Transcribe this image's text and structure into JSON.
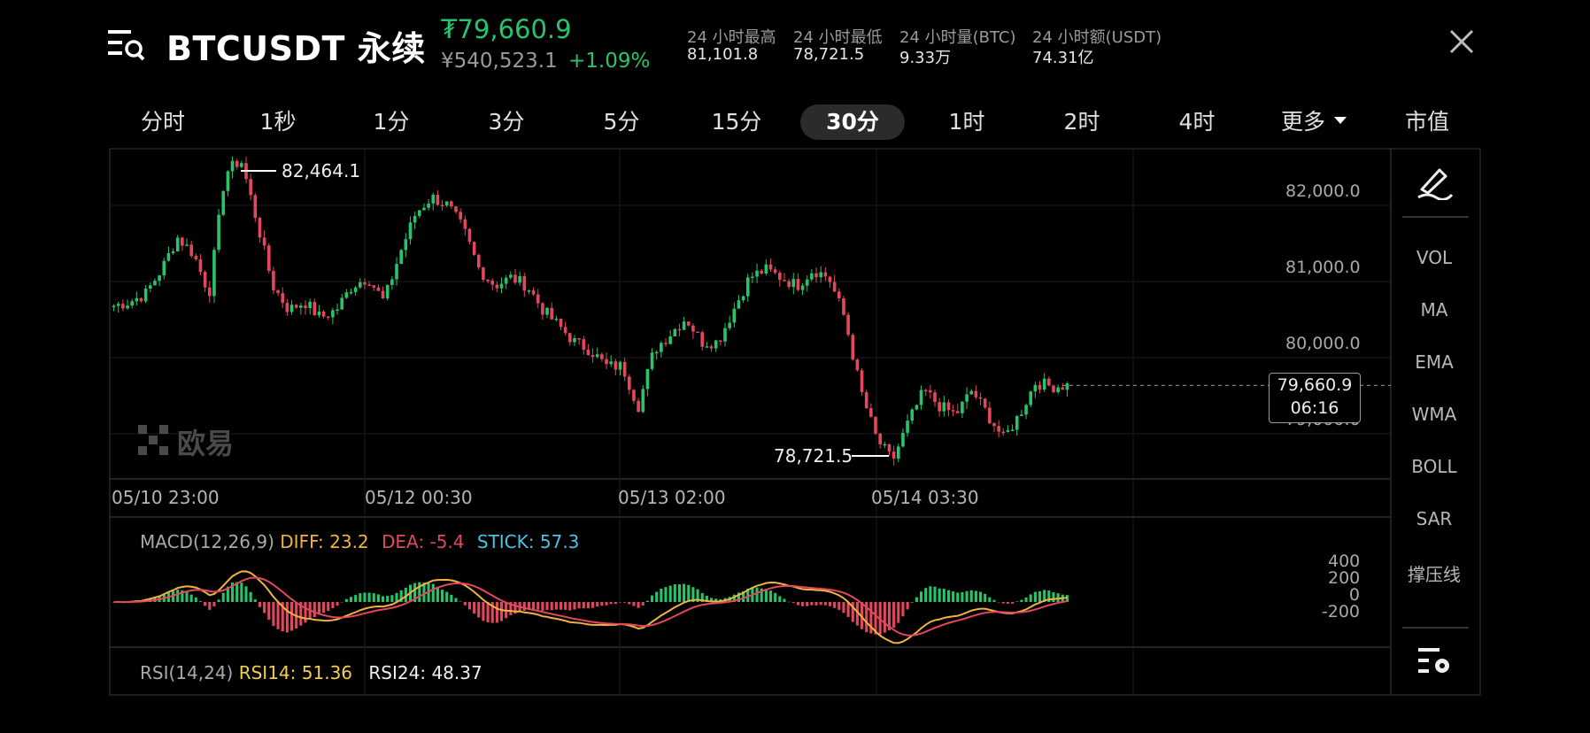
{
  "header": {
    "symbol": "BTCUSDT 永续",
    "last_price": "₮79,660.9",
    "cny_price": "¥540,523.1",
    "change_pct": "+1.09%",
    "stats": [
      {
        "label": "24 小时最高",
        "value": "81,101.8"
      },
      {
        "label": "24 小时最低",
        "value": "78,721.5"
      },
      {
        "label": "24 小时量(BTC)",
        "value": "9.33万"
      },
      {
        "label": "24 小时额(USDT)",
        "value": "74.31亿"
      }
    ]
  },
  "timeframes": [
    "分时",
    "1秒",
    "1分",
    "3分",
    "5分",
    "15分",
    "30分",
    "1时",
    "2时",
    "4时",
    "更多",
    "市值"
  ],
  "active_timeframe": "30分",
  "main_chart": {
    "high_marker": "82,464.1",
    "low_marker": "78,721.5",
    "y_labels": [
      "82,000.0",
      "81,000.0",
      "80,000.0",
      "79,000.0"
    ],
    "x_labels": [
      "05/10 23:00",
      "05/12 00:30",
      "05/13 02:00",
      "05/14 03:30"
    ],
    "current_price": "79,660.9",
    "countdown": "06:16",
    "watermark": "欧易"
  },
  "indicators": [
    "VOL",
    "MA",
    "EMA",
    "WMA",
    "BOLL",
    "SAR",
    "撑压线"
  ],
  "macd": {
    "title": "MACD(12,26,9)",
    "diff_label": "DIFF:",
    "diff_value": "23.2",
    "dea_label": "DEA:",
    "dea_value": "-5.4",
    "stick_label": "STICK:",
    "stick_value": "57.3",
    "y_labels": [
      "400",
      "200",
      "0",
      "-200"
    ]
  },
  "rsi": {
    "title": "RSI(14,24)",
    "rsi14_label": "RSI14:",
    "rsi14_value": "51.36",
    "rsi24_label": "RSI24:",
    "rsi24_value": "48.37"
  },
  "colors": {
    "up": "#27c46b",
    "down": "#e4475d",
    "diff": "#f0b33f",
    "dea": "#e4475d",
    "stick": "#4cc3e0",
    "rsi14": "#f2d04b"
  },
  "chart_data": {
    "type": "candlestick",
    "ylim": [
      78500,
      82600
    ],
    "x_labels": [
      "05/10 23:00",
      "05/12 00:30",
      "05/13 02:00",
      "05/14 03:30"
    ],
    "close_path": [
      80650,
      80700,
      80800,
      81100,
      81500,
      81300,
      80800,
      82300,
      82464,
      81700,
      80900,
      80600,
      80700,
      80500,
      80600,
      80900,
      81000,
      80700,
      81300,
      81800,
      82000,
      81900,
      81600,
      81100,
      80900,
      81000,
      80900,
      80600,
      80400,
      80200,
      80100,
      79900,
      79900,
      79400,
      80100,
      80300,
      80500,
      80200,
      80200,
      80600,
      81000,
      81100,
      81000,
      80900,
      81100,
      81000,
      80500,
      79600,
      79000,
      78722,
      79200,
      79600,
      79400,
      79300,
      79600,
      79300,
      79000,
      79300,
      79700,
      79650,
      79661
    ],
    "high": 82464.1,
    "low": 78721.5,
    "last": 79660.9
  }
}
